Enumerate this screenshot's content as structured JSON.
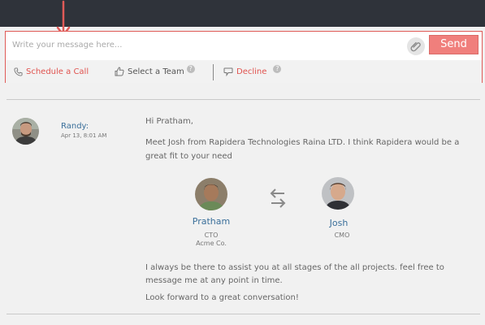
{
  "composer": {
    "placeholder": "Write your message here...",
    "send_label": "Send",
    "actions": {
      "schedule_label": "Schedule a Call",
      "team_label": "Select a Team",
      "team_help": "?",
      "decline_label": "Decline",
      "decline_help": "?"
    }
  },
  "message": {
    "sender": "Randy:",
    "timestamp": "Apr 13, 8:01 AM",
    "greeting": "Hi Pratham,",
    "intro": "Meet Josh from Rapidera Technologies Raina LTD. I think Rapidera would be a great fit to your need",
    "introduction": {
      "left": {
        "name": "Pratham",
        "role": "CTO",
        "company": "Acme Co."
      },
      "right": {
        "name": "Josh",
        "role": "CMO"
      }
    },
    "assist": "I always be there to assist you at all stages of the all projects. feel free to message me at any point in time.",
    "closing": "Look forward to a great conversation!"
  },
  "colors": {
    "accent": "#e0534f",
    "send": "#f07f7c",
    "link": "#3a6f9a",
    "topbar": "#2f333a"
  },
  "icons": {
    "arrow": "red-down-arrow-icon",
    "attach": "paperclip-icon",
    "schedule": "phone-icon",
    "team": "thumbs-up-icon",
    "decline": "speech-bubble-icon",
    "swap": "swap-arrows-icon"
  }
}
